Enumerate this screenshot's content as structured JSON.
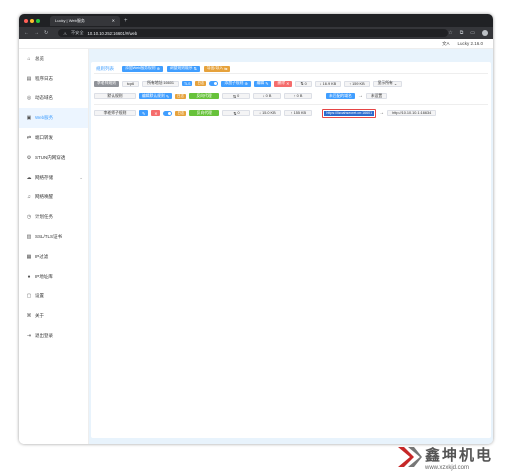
{
  "browser": {
    "tab_title": "Lucky | Web服务",
    "url": "10.10.10.252:16601/#/web",
    "security_label": "不安全"
  },
  "app": {
    "lang_icon": "translate-icon",
    "version": "Lucky 2.16.0"
  },
  "sidebar": {
    "items": [
      {
        "label": "总览",
        "icon": "home-icon"
      },
      {
        "label": "程序日志",
        "icon": "log-icon"
      },
      {
        "label": "动态域名",
        "icon": "ddns-icon"
      },
      {
        "label": "Web服务",
        "icon": "web-icon"
      },
      {
        "label": "端口转发",
        "icon": "port-forward-icon"
      },
      {
        "label": "STUN内网穿透",
        "icon": "stun-icon"
      },
      {
        "label": "网络存储",
        "icon": "cloud-icon"
      },
      {
        "label": "网络唤醒",
        "icon": "bell-icon"
      },
      {
        "label": "计划任务",
        "icon": "clock-icon"
      },
      {
        "label": "SSL/TLS证书",
        "icon": "cert-icon"
      },
      {
        "label": "IP过滤",
        "icon": "filter-icon"
      },
      {
        "label": "设置",
        "icon": "settings-icon"
      },
      {
        "label": "关于",
        "icon": "info-icon"
      },
      {
        "label": "退出登录",
        "icon": "logout-icon"
      }
    ],
    "extra_items": [
      {
        "label": "IP过滤",
        "icon": "filter-icon"
      },
      {
        "label": "IP地址库",
        "icon": "database-icon"
      }
    ]
  },
  "main": {
    "tab_label": "规则列表",
    "actions": {
      "add": "添加Web服务规则",
      "adjust": "调整规则顺序",
      "import": "导出/导入"
    },
    "rule": {
      "name": "李老师规则",
      "protocol": "tcp6",
      "port_label": "所有地址:16601",
      "tls": "TLS",
      "log": "日志",
      "toggle_label": "启用",
      "add_sub": "添加子规则",
      "edit": "编辑",
      "delete": "删除",
      "stat1": "0",
      "stat2": "16.9 KB",
      "stat3": "159 KB",
      "show_all": "显示所有"
    },
    "sub_rules": [
      {
        "name": "默认规则",
        "type": "编辑默认规则",
        "log": "日志",
        "status": "反向代理",
        "stat1": "0",
        "stat2": "0 B",
        "stat3": "0 B",
        "target_a": "未匹配的域名",
        "target_b": "未设置"
      },
      {
        "name": "李老师子规则",
        "log": "日志",
        "status": "反向代理",
        "stat1": "0",
        "stat2": "15.0 KB",
        "stat3": "155 KB",
        "source": "https://lizoahsecret.cn:16601",
        "arrow": "→",
        "target": "http://10.10.10.1:16634"
      }
    ]
  },
  "watermark": {
    "title": "鑫坤机电",
    "url": "www.xzxkjd.com"
  },
  "colors": {
    "accent": "#409eff",
    "main_bg": "#e8f3fc",
    "highlight": "#e64545"
  }
}
